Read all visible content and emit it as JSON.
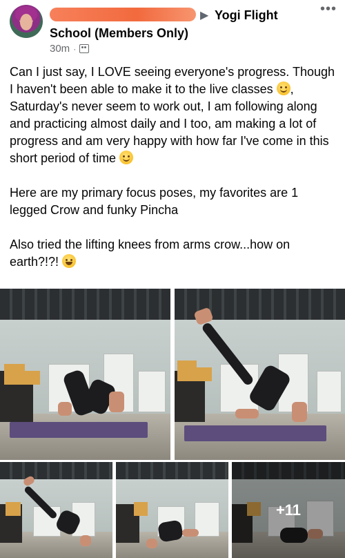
{
  "post": {
    "group_line1": "Yogi Flight",
    "group_line2": "School (Members Only)",
    "separator": "▶",
    "time": "30m",
    "meta_dot": "·",
    "more_label": "•••",
    "paragraphs": {
      "p1_text_a": "Can I just say, I LOVE seeing everyone's progress. Though I haven't been able to make it to the live classes ",
      "p1_text_b": ", Saturday's never seem to work out, I am following along and practicing almost daily and I too, am making a lot of progress and am very happy with how far I've come in this short period of time ",
      "p2": "Here are my primary focus poses, my favorites are 1 legged Crow and funky Pincha",
      "p3": "Also tried the lifting knees from arms crow...how on earth?!?! "
    },
    "emojis": [
      "pensive-face-emoji",
      "smiling-face-emoji",
      "tears-of-joy-emoji"
    ],
    "photos": {
      "more_count": "+11"
    }
  }
}
